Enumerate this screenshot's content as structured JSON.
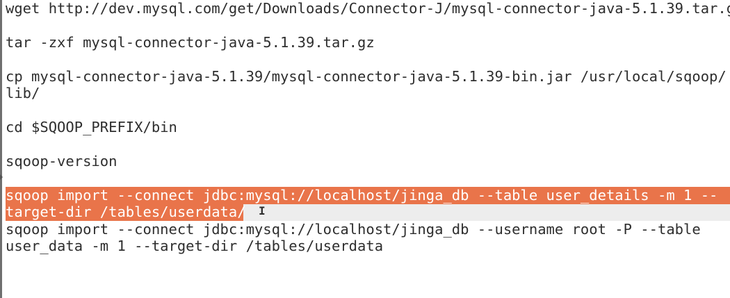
{
  "editor": {
    "lines": [
      "wget http://dev.mysql.com/get/Downloads/Connector-J/mysql-connector-java-5.1.39.tar.g",
      "tar -zxf mysql-connector-java-5.1.39.tar.gz",
      "cp mysql-connector-java-5.1.39/mysql-connector-java-5.1.39-bin.jar /usr/local/sqoop/",
      "lib/",
      "cd $SQOOP_PREFIX/bin",
      "sqoop-version",
      "sqoop import --connect jdbc:mysql://localhost/jinga_db --table user_details -m 1 --",
      "target-dir /tables/userdata/",
      "sqoop import --connect jdbc:mysql://localhost/jinga_db --username root -P --table",
      "user_data -m 1 --target-dir /tables/userdata"
    ],
    "selection_color": "#e9744a",
    "cursor_glyph": "I"
  }
}
